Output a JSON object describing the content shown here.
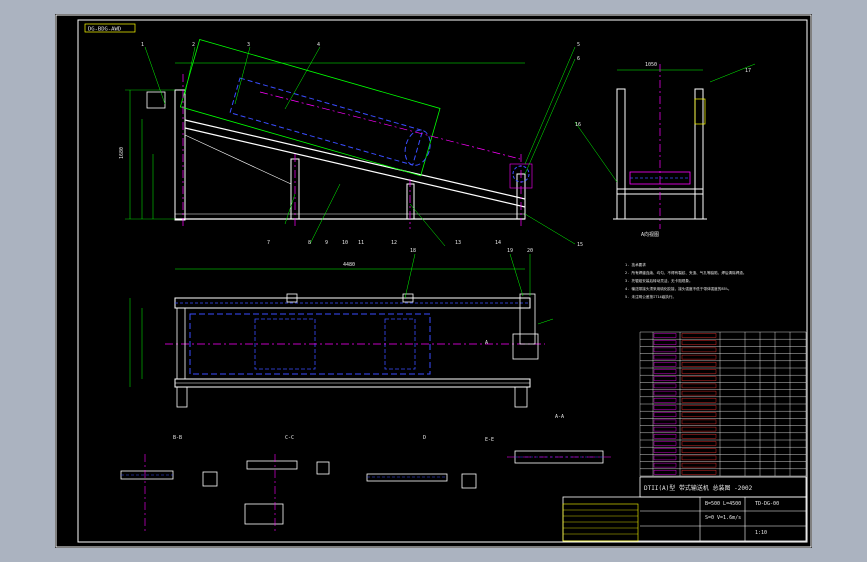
{
  "drawing": {
    "stamp": "DG-BDG-AWD",
    "view_labels": {
      "side_view": "A向视图",
      "plan_top": "A",
      "a_a": "A-A",
      "b_b": "B-B",
      "c_c": "C-C",
      "d_d": "D",
      "e_e": "E-E"
    },
    "callouts": [
      "1",
      "2",
      "3",
      "4",
      "5",
      "6",
      "7",
      "8",
      "9",
      "10",
      "11",
      "12",
      "13",
      "14",
      "15",
      "16",
      "17",
      "18",
      "19",
      "20"
    ],
    "dimensions": {
      "total_length": "4480",
      "height": "1680",
      "width": "1050"
    },
    "tech_notes": [
      "1. 技术要求",
      "2. 所有焊缝连续、均匀，不得有裂纹、夹渣、气孔等缺陷，焊后清除焊渣。",
      "3. 托辊组安装后转动灵活，无卡阻现象。",
      "4. 输送带接头须采用硫化胶接，接头强度不低于带体强度的85%。",
      "5. 未注明公差按IT14级执行。"
    ],
    "title_block": {
      "title": "DTII(A)型 带式输送机 总装图 -2002",
      "spec1": "B=500  L=4500",
      "spec2": "S=0  V=1.6m/s",
      "drawing_no": "TD-DG-00",
      "scale": "1:10"
    }
  },
  "colors": {
    "sheet": "#000000",
    "frame": "#ffffff",
    "green": "#00ff00",
    "blue": "#3a4dff",
    "magenta": "#ff00ff",
    "yellow": "#ffff00",
    "cyan": "#00ffff",
    "red": "#ff3030"
  }
}
